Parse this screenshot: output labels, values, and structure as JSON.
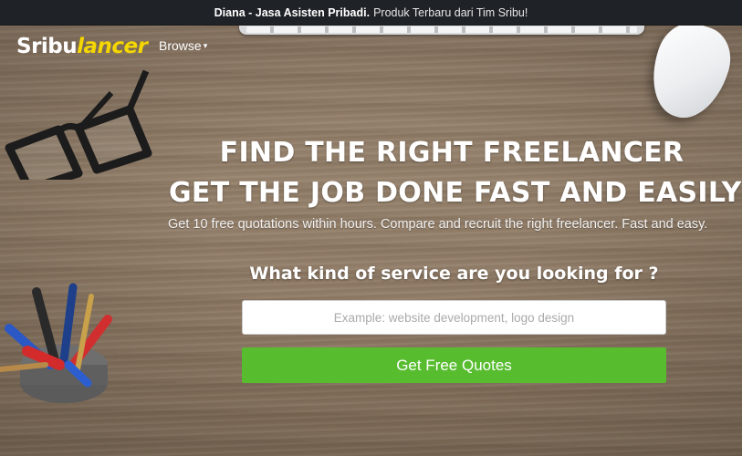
{
  "announcement": {
    "bold_text": "Diana - Jasa Asisten Pribadi.",
    "normal_text": "Produk Terbaru dari Tim Sribu!"
  },
  "brand": {
    "part1": "Sribu",
    "part2": "lancer"
  },
  "nav": {
    "browse_label": "Browse",
    "browse_caret": "▾"
  },
  "hero": {
    "title_line1": "FIND THE RIGHT FREELANCER",
    "title_line2": "GET THE JOB DONE FAST AND EASILY",
    "subtitle": "Get 10 free quotations within hours. Compare and recruit the right freelancer. Fast and easy."
  },
  "search": {
    "question": "What kind of service are you looking for ?",
    "placeholder": "Example: website development, logo design",
    "value": ""
  },
  "cta": {
    "label": "Get Free Quotes"
  },
  "colors": {
    "topbar_bg": "#1f2327",
    "brand_accent": "#f4d600",
    "cta_green": "#57bd2f"
  }
}
